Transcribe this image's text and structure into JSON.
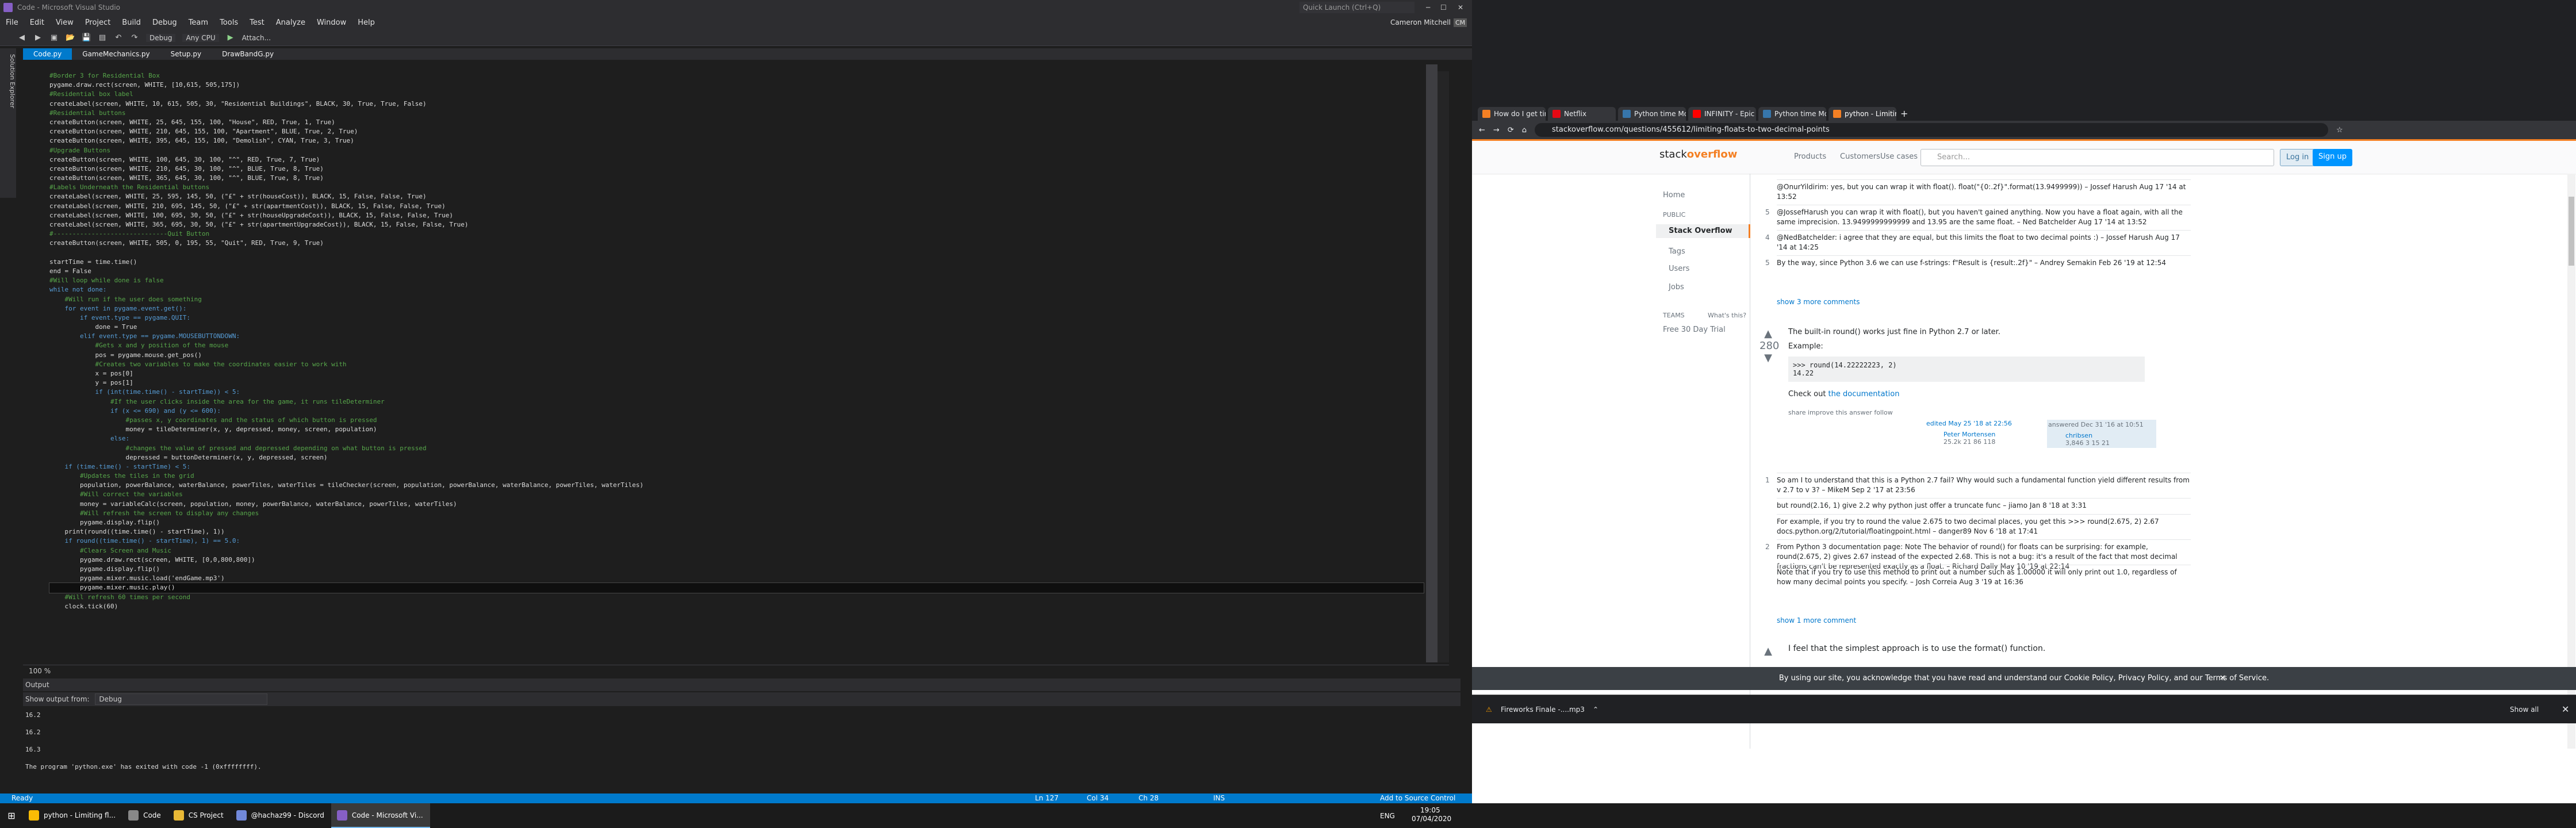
{
  "vs": {
    "title": "Code - Microsoft Visual Studio",
    "quick_launch": "Quick Launch (Ctrl+Q)",
    "user": "Cameron Mitchell",
    "user_initials": "CM",
    "menu": [
      "File",
      "Edit",
      "View",
      "Project",
      "Build",
      "Debug",
      "Team",
      "Tools",
      "Test",
      "Analyze",
      "Window",
      "Help"
    ],
    "toolbar": {
      "config": "Debug",
      "platform": "Any CPU",
      "attach": "Attach..."
    },
    "tabs": [
      "Code.py",
      "GameMechanics.py",
      "Setup.py",
      "DrawBandG.py"
    ],
    "left_sidebar": "Solution Explorer",
    "zoom": "100 %",
    "output_title": "Output",
    "output_from_label": "Show output from:",
    "output_from_value": "Debug",
    "output_lines": [
      "16.2",
      "",
      "16.2",
      "",
      "16.3",
      "",
      "The program 'python.exe' has exited with code -1 (0xffffffff)."
    ],
    "status": {
      "left": "Ready",
      "ln": "Ln 127",
      "col": "Col 34",
      "ch": "Ch 28",
      "mode": "INS",
      "right": "Add to Source Control"
    }
  },
  "code_lines": [
    {
      "c": "cm",
      "t": "#Border 3 for Residential Box"
    },
    {
      "c": "tx",
      "t": "pygame.draw.rect(screen, WHITE, [10,615, 505,175])"
    },
    {
      "c": "cm",
      "t": "#Residential box label"
    },
    {
      "c": "tx",
      "t": "createLabel(screen, WHITE, 10, 615, 505, 30, \"Residential Buildings\", BLACK, 30, True, True, False)"
    },
    {
      "c": "cm",
      "t": "#Residential buttons"
    },
    {
      "c": "tx",
      "t": "createButton(screen, WHITE, 25, 645, 155, 100, \"House\", RED, True, 1, True)"
    },
    {
      "c": "tx",
      "t": "createButton(screen, WHITE, 210, 645, 155, 100, \"Apartment\", BLUE, True, 2, True)"
    },
    {
      "c": "tx",
      "t": "createButton(screen, WHITE, 395, 645, 155, 100, \"Demolish\", CYAN, True, 3, True)"
    },
    {
      "c": "cm",
      "t": "#Upgrade Buttons"
    },
    {
      "c": "tx",
      "t": "createButton(screen, WHITE, 100, 645, 30, 100, \"^\", RED, True, 7, True)"
    },
    {
      "c": "tx",
      "t": "createButton(screen, WHITE, 210, 645, 30, 100, \"^\", BLUE, True, 8, True)"
    },
    {
      "c": "tx",
      "t": "createButton(screen, WHITE, 365, 645, 30, 100, \"^\", BLUE, True, 8, True)"
    },
    {
      "c": "cm",
      "t": "#Labels Underneath the Residential buttons"
    },
    {
      "c": "tx",
      "t": "createLabel(screen, WHITE, 25, 595, 145, 50, (\"£\" + str(houseCost)), BLACK, 15, False, False, True)"
    },
    {
      "c": "tx",
      "t": "createLabel(screen, WHITE, 210, 695, 145, 50, (\"£\" + str(apartmentCost)), BLACK, 15, False, False, True)"
    },
    {
      "c": "tx",
      "t": "createLabel(screen, WHITE, 100, 695, 30, 50, (\"£\" + str(houseUpgradeCost)), BLACK, 15, False, False, True)"
    },
    {
      "c": "tx",
      "t": "createLabel(screen, WHITE, 365, 695, 30, 50, (\"£\" + str(apartmentUpgradeCost)), BLACK, 15, False, False, True)"
    },
    {
      "c": "cm",
      "t": "#------------------------------Quit Button"
    },
    {
      "c": "tx",
      "t": "createButton(screen, WHITE, 505, 0, 195, 55, \"Quit\", RED, True, 9, True)"
    },
    {
      "c": "tx",
      "t": ""
    },
    {
      "c": "tx",
      "t": "startTime = time.time()"
    },
    {
      "c": "tx",
      "t": "end = False"
    },
    {
      "c": "cm",
      "t": "#Will loop while done is false"
    },
    {
      "c": "kw",
      "t": "while not done:"
    },
    {
      "c": "cm",
      "t": "    #Will run if the user does something"
    },
    {
      "c": "kw",
      "t": "    for event in pygame.event.get():"
    },
    {
      "c": "kw",
      "t": "        if event.type == pygame.QUIT:"
    },
    {
      "c": "tx",
      "t": "            done = True"
    },
    {
      "c": "kw",
      "t": "        elif event.type == pygame.MOUSEBUTTONDOWN:"
    },
    {
      "c": "cm",
      "t": "            #Gets x and y position of the mouse"
    },
    {
      "c": "tx",
      "t": "            pos = pygame.mouse.get_pos()"
    },
    {
      "c": "cm",
      "t": "            #Creates two variables to make the coordinates easier to work with"
    },
    {
      "c": "tx",
      "t": "            x = pos[0]"
    },
    {
      "c": "tx",
      "t": "            y = pos[1]"
    },
    {
      "c": "kw",
      "t": "            if (int(time.time() - startTime)) < 5:"
    },
    {
      "c": "cm",
      "t": "                #If the user clicks inside the area for the game, it runs tileDeterminer"
    },
    {
      "c": "kw",
      "t": "                if (x <= 690) and (y <= 600):"
    },
    {
      "c": "cm",
      "t": "                    #passes x, y coordinates and the status of which button is pressed"
    },
    {
      "c": "tx",
      "t": "                    money = tileDeterminer(x, y, depressed, money, screen, population)"
    },
    {
      "c": "kw",
      "t": "                else:"
    },
    {
      "c": "cm",
      "t": "                    #changes the value of pressed and depressed depending on what button is pressed"
    },
    {
      "c": "tx",
      "t": "                    depressed = buttonDeterminer(x, y, depressed, screen)"
    },
    {
      "c": "kw",
      "t": "    if (time.time() - startTime) < 5:"
    },
    {
      "c": "cm",
      "t": "        #Updates the tiles in the grid"
    },
    {
      "c": "tx",
      "t": "        population, powerBalance, waterBalance, powerTiles, waterTiles = tileChecker(screen, population, powerBalance, waterBalance, powerTiles, waterTiles)"
    },
    {
      "c": "cm",
      "t": "        #Will correct the variables"
    },
    {
      "c": "tx",
      "t": "        money = variableCalc(screen, population, money, powerBalance, waterBalance, powerTiles, waterTiles)"
    },
    {
      "c": "cm",
      "t": "        #Will refresh the screen to display any changes"
    },
    {
      "c": "tx",
      "t": "        pygame.display.flip()"
    },
    {
      "c": "tx",
      "t": "    print(round((time.time() - startTime), 1))"
    },
    {
      "c": "kw",
      "t": "    if round((time.time() - startTime), 1) == 5.0:"
    },
    {
      "c": "cm",
      "t": "        #Clears Screen and Music"
    },
    {
      "c": "tx",
      "t": "        pygame.draw.rect(screen, WHITE, [0,0,800,800])"
    },
    {
      "c": "tx",
      "t": "        pygame.display.flip()"
    },
    {
      "c": "tx",
      "t": "        pygame.mixer.music.load('endGame.mp3')"
    },
    {
      "c": "tx",
      "t": "        pygame.mixer.music.play()"
    },
    {
      "c": "cm",
      "t": "    #Will refresh 60 times per second"
    },
    {
      "c": "tx",
      "t": "    clock.tick(60)"
    }
  ],
  "browser": {
    "tabs": [
      {
        "label": "How do I get time of a Python p...",
        "color": "#f48024"
      },
      {
        "label": "Netflix",
        "color": "#e50914"
      },
      {
        "label": "Python time Module (with Exam...",
        "color": "#3776ab"
      },
      {
        "label": "INFINITY - Epic Futuristic Music",
        "color": "#ff0000"
      },
      {
        "label": "Python time Module (with Exam...",
        "color": "#3776ab"
      },
      {
        "label": "python - Limiting floats to two d...",
        "color": "#f48024"
      }
    ],
    "new_tab": "+",
    "url": "stackoverflow.com/questions/455612/limiting-floats-to-two-decimal-points"
  },
  "so": {
    "logo_a": "stack",
    "logo_b": "overflow",
    "nav": [
      "Products",
      "Customers",
      "Use cases"
    ],
    "search_placeholder": "Search...",
    "login": "Log in",
    "signup": "Sign up",
    "left": [
      "Home",
      "PUBLIC",
      "Stack Overflow",
      "Tags",
      "Users",
      "Jobs",
      "TEAMS",
      "What's this?",
      "Free 30 Day Trial"
    ],
    "comments_top": [
      {
        "score": "",
        "text": "@OnurYildirim: yes, but you can wrap it with float(). float(\"{0:.2f}\".format(13.9499999)) – Jossef Harush Aug 17 '14 at 13:52"
      },
      {
        "score": "5",
        "text": "@JossefHarush you can wrap it with float(), but you haven't gained anything. Now you have a float again, with all the same imprecision. 13.9499999999999 and 13.95 are the same float. – Ned Batchelder Aug 17 '14 at 13:52"
      },
      {
        "score": "4",
        "text": "@NedBatchelder: i agree that they are equal, but this limits the float to two decimal points :) – Jossef Harush Aug 17 '14 at 14:25"
      },
      {
        "score": "5",
        "text": "By the way, since Python 3.6 we can use f-strings: f\"Result is {result:.2f}\" – Andrey Semakin Feb 26 '19 at 12:54"
      }
    ],
    "show_more_1": "show 3 more comments",
    "answer_score": "280",
    "answer_text1": "The built-in round() works just fine in Python 2.7 or later.",
    "answer_example": "Example:",
    "answer_code": ">>> round(14.22222223, 2)\n14.22",
    "answer_check": "Check out ",
    "answer_link": "the documentation",
    "answer_actions": "share  improve this answer  follow",
    "edited": "edited May 25 '18 at 22:56",
    "editor": "Peter Mortensen",
    "editor_rep": "25.2k  21  86  118",
    "answered": "answered Dec 31 '16 at 10:51",
    "answerer": "chribsen",
    "answerer_rep": "3,846  3  15  21",
    "comments_bottom": [
      {
        "score": "1",
        "text": "So am I to understand that this is a Python 2.7 fail? Why would such a fundamental function yield different results from v 2.7 to v 3? – MikeM Sep 2 '17 at 23:56"
      },
      {
        "score": "",
        "text": "but round(2.16, 1) give 2.2 why python just offer a truncate func – jiamo Jan 8 '18 at 3:31"
      },
      {
        "score": "",
        "text": "For example, if you try to round the value 2.675 to two decimal places, you get this >>> round(2.675, 2) 2.67 docs.python.org/2/tutorial/floatingpoint.html – danger89 Nov 6 '18 at 17:41"
      },
      {
        "score": "2",
        "text": "From Python 3 documentation page: Note The behavior of round() for floats can be surprising: for example, round(2.675, 2) gives 2.67 instead of the expected 2.68. This is not a bug: it's a result of the fact that most decimal fractions can't be represented exactly as a float. – Richard Dally May 10 '19 at 22:14"
      },
      {
        "score": "",
        "text": "Note that if you try to use this method to print out a number such as 1.00000 it will only print out 1.0, regardless of how many decimal points you specify. – Josh Correia Aug 3 '19 at 16:36"
      }
    ],
    "show_more_2": "show 1 more comment",
    "next_answer": "I feel that the simplest approach is to use the format() function.",
    "cookie": "By using our site, you acknowledge that you have read and understand our Cookie Policy, Privacy Policy, and our Terms of Service.",
    "download": "Fireworks Finale -....mp3",
    "show_all": "Show all"
  },
  "taskbar": [
    {
      "label": "python - Limiting fl...",
      "color": "#fbbc05",
      "active": false
    },
    {
      "label": "Code",
      "color": "#888",
      "active": false
    },
    {
      "label": "CS Project",
      "color": "#e8b836",
      "active": false
    },
    {
      "label": "@hachaz99 - Discord",
      "color": "#7289da",
      "active": false
    },
    {
      "label": "Code - Microsoft Vi...",
      "color": "#865fc5",
      "active": true
    }
  ],
  "tray": {
    "lang": "ENG",
    "time": "19:05",
    "date": "07/04/2020"
  }
}
